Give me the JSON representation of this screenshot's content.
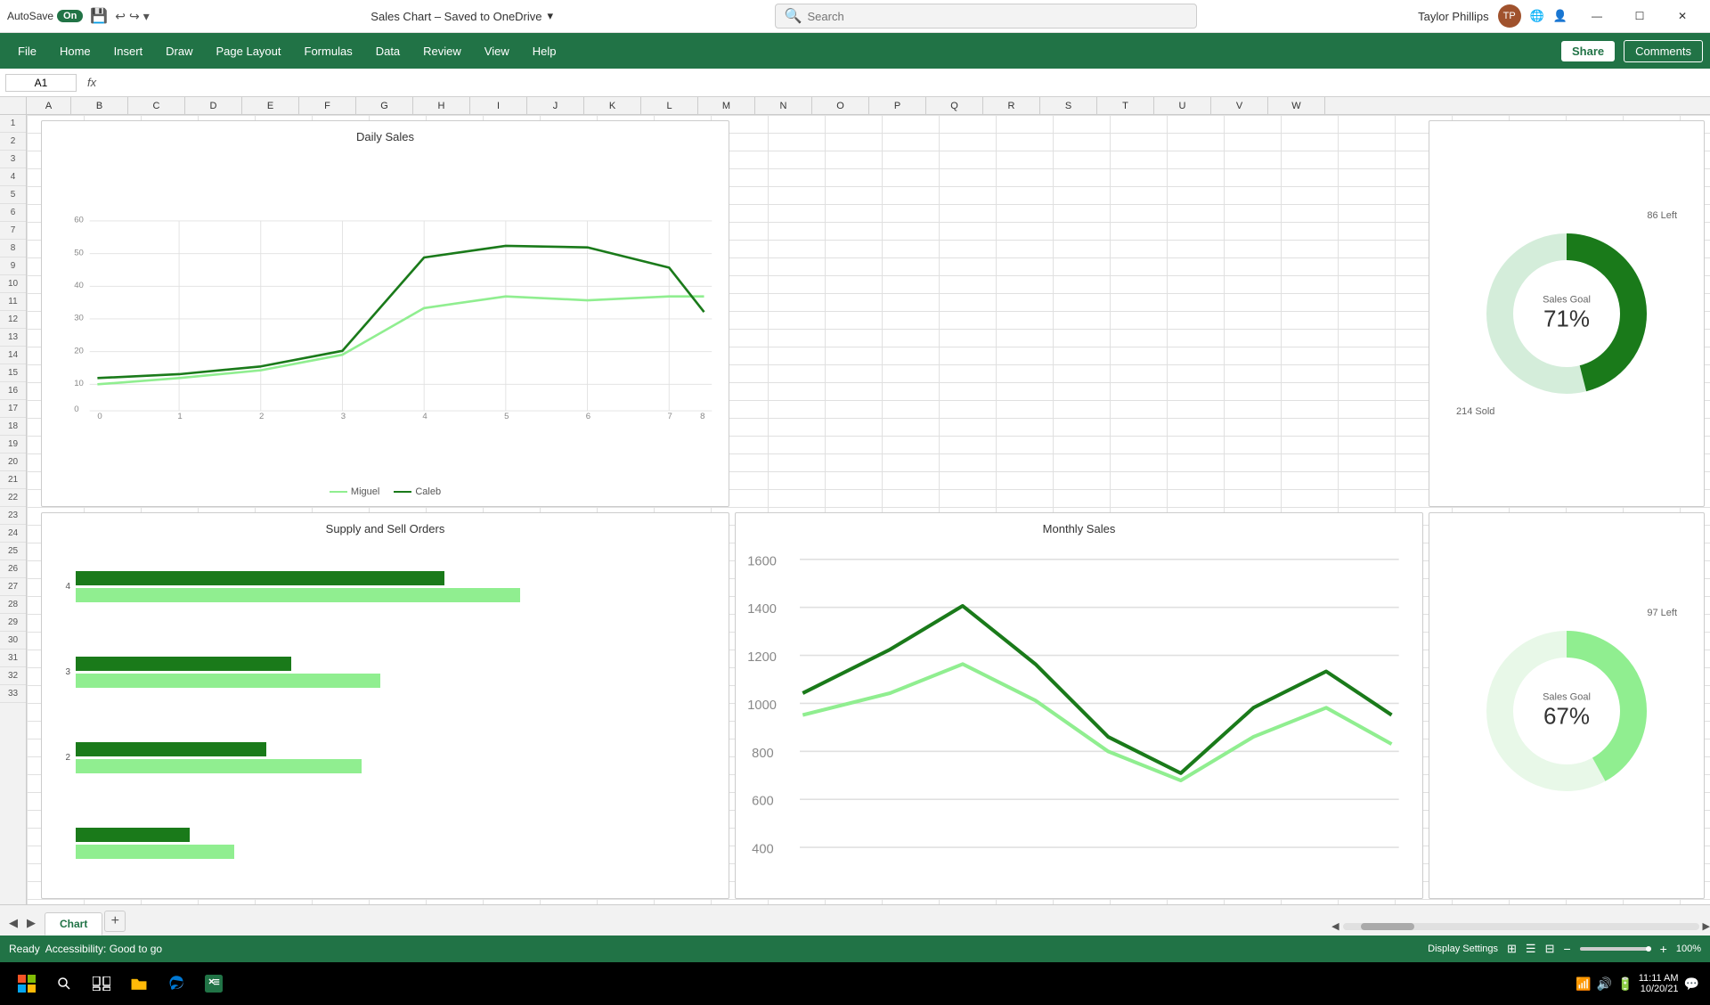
{
  "titlebar": {
    "autosave_label": "AutoSave",
    "autosave_state": "On",
    "file_title": "Sales Chart – Saved to OneDrive",
    "search_placeholder": "Search",
    "user_name": "Taylor Phillips",
    "minimize": "—",
    "maximize": "☐",
    "close": "✕"
  },
  "menubar": {
    "items": [
      "File",
      "Home",
      "Insert",
      "Draw",
      "Page Layout",
      "Formulas",
      "Data",
      "Review",
      "View",
      "Help"
    ],
    "share_label": "Share",
    "comments_label": "Comments"
  },
  "formulabar": {
    "cell_ref": "A1",
    "fx": "fx"
  },
  "columns": [
    "A",
    "B",
    "C",
    "D",
    "E",
    "F",
    "G",
    "H",
    "I",
    "J",
    "K",
    "L",
    "M",
    "N",
    "O",
    "P",
    "Q",
    "R",
    "S",
    "T",
    "U",
    "V",
    "W"
  ],
  "rows": [
    1,
    2,
    3,
    4,
    5,
    6,
    7,
    8,
    9,
    10,
    11,
    12,
    13,
    14,
    15,
    16,
    17,
    18,
    19,
    20,
    21,
    22,
    23,
    24,
    25,
    26,
    27,
    28,
    29,
    30,
    31,
    32,
    33
  ],
  "charts": {
    "daily_sales": {
      "title": "Daily Sales",
      "legend": [
        {
          "label": "Miguel",
          "color": "#90EE90"
        },
        {
          "label": "Caleb",
          "color": "#1a7a1a"
        }
      ]
    },
    "supply_sell": {
      "title": "Supply and Sell Orders"
    },
    "monthly_sales": {
      "title": "Monthly Sales"
    },
    "donut1": {
      "left_label": "86 Left",
      "bottom_label": "214 Sold",
      "center_label": "Sales Goal",
      "percentage": "71%",
      "pct_value": 71,
      "color_main": "#1a8a1a",
      "color_light": "#d4edda"
    },
    "donut2": {
      "left_label": "97 Left",
      "bottom_label": "",
      "center_label": "Sales Goal",
      "percentage": "67%",
      "pct_value": 67,
      "color_main": "#90EE90",
      "color_light": "#e8f8e8"
    }
  },
  "status": {
    "ready": "Ready",
    "accessibility": "Accessibility: Good to go",
    "display_settings": "Display Settings",
    "zoom": "100%",
    "date": "10/20/21",
    "time": "11:11 AM"
  },
  "sheet_tabs": [
    "Chart"
  ],
  "colors": {
    "excel_green": "#217346",
    "bar_dark": "#1a7a1a",
    "bar_light": "#90EE90"
  }
}
